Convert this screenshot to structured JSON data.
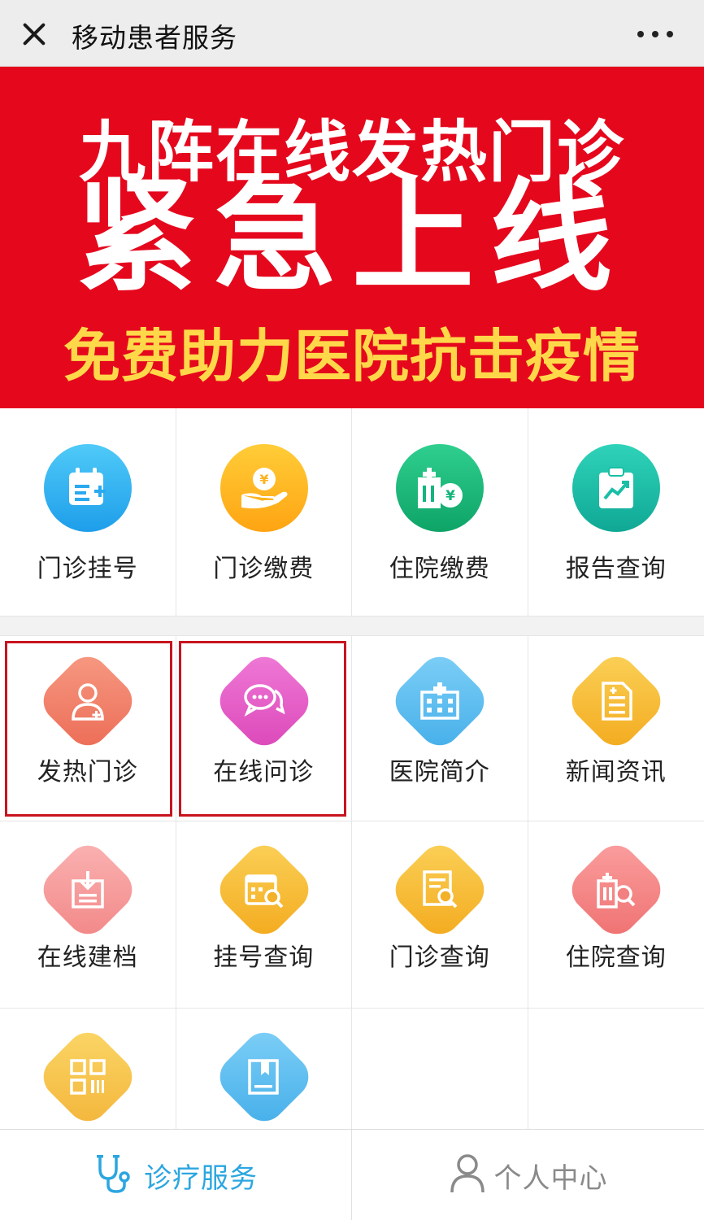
{
  "window": {
    "title": "移动患者服务",
    "close_icon": "close-icon",
    "more_icon": "more-icon"
  },
  "banner": {
    "line1": "九阵在线发热门诊",
    "line2": "紧急上线",
    "line3": "免费助力医院抗击疫情",
    "bg_color": "#e5081d",
    "accent_color": "#ffd84a"
  },
  "main_services": [
    {
      "label": "门诊挂号",
      "icon": "calendar-plus-icon",
      "color": "#2bb5f0"
    },
    {
      "label": "门诊缴费",
      "icon": "yen-hand-icon",
      "color": "#ffb21d"
    },
    {
      "label": "住院缴费",
      "icon": "hospital-yen-icon",
      "color": "#14b47c"
    },
    {
      "label": "报告查询",
      "icon": "clipboard-chart-icon",
      "color": "#18bfa6"
    }
  ],
  "services": [
    {
      "label": "发热门诊",
      "icon": "doctor-icon",
      "color": "#f07a63",
      "highlighted": true
    },
    {
      "label": "在线问诊",
      "icon": "chat-bubbles-icon",
      "color": "#e85cc5",
      "highlighted": true
    },
    {
      "label": "医院简介",
      "icon": "hospital-building-icon",
      "color": "#5cbcf0"
    },
    {
      "label": "新闻资讯",
      "icon": "document-icon",
      "color": "#f6bb31"
    },
    {
      "label": "在线建档",
      "icon": "file-download-icon",
      "color": "#f79a9a"
    },
    {
      "label": "挂号查询",
      "icon": "calendar-search-icon",
      "color": "#f6bb31"
    },
    {
      "label": "门诊查询",
      "icon": "document-search-icon",
      "color": "#f6bb31"
    },
    {
      "label": "住院查询",
      "icon": "building-search-icon",
      "color": "#f58a8a"
    },
    {
      "label": "",
      "icon": "qr-code-icon",
      "color": "#f6c548"
    },
    {
      "label": "",
      "icon": "book-icon",
      "color": "#5cbcf0"
    }
  ],
  "tabbar": {
    "tabs": [
      {
        "label": "诊疗服务",
        "icon": "stethoscope-icon",
        "active": true
      },
      {
        "label": "个人中心",
        "icon": "person-icon",
        "active": false
      }
    ],
    "active_color": "#2ba6e0",
    "inactive_color": "#8a8a8a"
  }
}
